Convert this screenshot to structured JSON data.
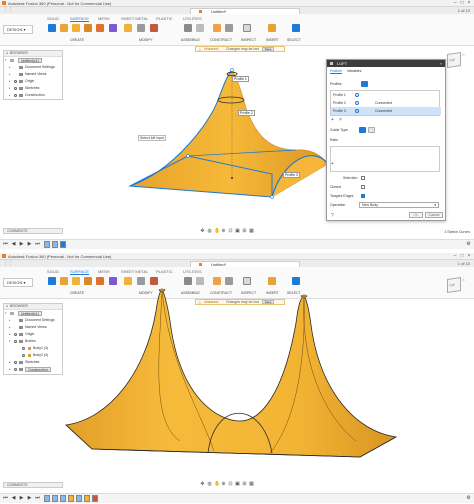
{
  "screens": [
    {
      "title": "Autodesk Fusion 360 (Personal - Not for Commercial Use)",
      "doc_tab": "Untitled*",
      "tab_right": "1 of 10",
      "design_label": "DESIGN",
      "ribbon_tabs": [
        "SOLID",
        "SURFACE",
        "MESH",
        "SHEET METAL",
        "PLASTIC",
        "UTILITIES"
      ],
      "groups": [
        "CREATE",
        "MODIFY",
        "ASSEMBLE",
        "CONSTRUCT",
        "INSPECT",
        "INSERT",
        "SELECT"
      ],
      "message": {
        "status": "Unsaved:",
        "text": "Changes may be lost",
        "save": "Save"
      },
      "browser": {
        "header": "BROWSER",
        "items": [
          "Untitled(v1)",
          "Document Settings",
          "Named Views",
          "Origin",
          "Sketches",
          "Construction"
        ]
      },
      "comments": "COMMENTS",
      "sketch_count": "3 Sketch Curves",
      "tooltip": "Select loft input",
      "profile_labels": [
        "Profile 1",
        "Profile 2",
        "Profile 3"
      ],
      "dialog": {
        "title": "LOFT",
        "tabs": [
          "Feature",
          "Variables"
        ],
        "profiles_label": "Profiles",
        "rows": [
          {
            "name": "Profile 1",
            "cond": ""
          },
          {
            "name": "Profile 2",
            "cond": "Connected"
          },
          {
            "name": "Profile 3",
            "cond": "Connected"
          }
        ],
        "rails_label": "Rails",
        "guide_type_label": "Guide Type",
        "selection_label": "Selection",
        "closed_label": "Closed",
        "tangent_edges_label": "Tangent Edges",
        "operation_label": "Operation",
        "operation_value": "New Body",
        "ok": "OK",
        "cancel": "Cancel"
      }
    },
    {
      "title": "Autodesk Fusion 360 (Personal - Not for Commercial Use)",
      "doc_tab": "Untitled*",
      "tab_right": "1 of 10",
      "design_label": "DESIGN",
      "ribbon_tabs": [
        "SOLID",
        "SURFACE",
        "MESH",
        "SHEET METAL",
        "PLASTIC",
        "UTILITIES"
      ],
      "groups": [
        "CREATE",
        "MODIFY",
        "ASSEMBLE",
        "CONSTRUCT",
        "INSPECT",
        "INSERT",
        "SELECT"
      ],
      "message": {
        "status": "Unsaved:",
        "text": "Changes may be lost",
        "save": "Save"
      },
      "browser": {
        "header": "BROWSER",
        "items": [
          "Untitled(v1)",
          "Document Settings",
          "Named Views",
          "Origin",
          "Bodies",
          "Body1 (4)",
          "Body2 (4)",
          "Sketches",
          "Construction"
        ]
      },
      "comments": "COMMENTS"
    }
  ],
  "colors": {
    "accent": "#1b7bd6",
    "surface": "#f2b234",
    "surface_dark": "#d89420",
    "edge": "#2a2a2a"
  },
  "icons": [
    "fusion-logo-icon",
    "app-grid-icon",
    "warning-icon",
    "eye-icon",
    "folder-icon",
    "play-icon",
    "gear-icon",
    "close-icon"
  ]
}
